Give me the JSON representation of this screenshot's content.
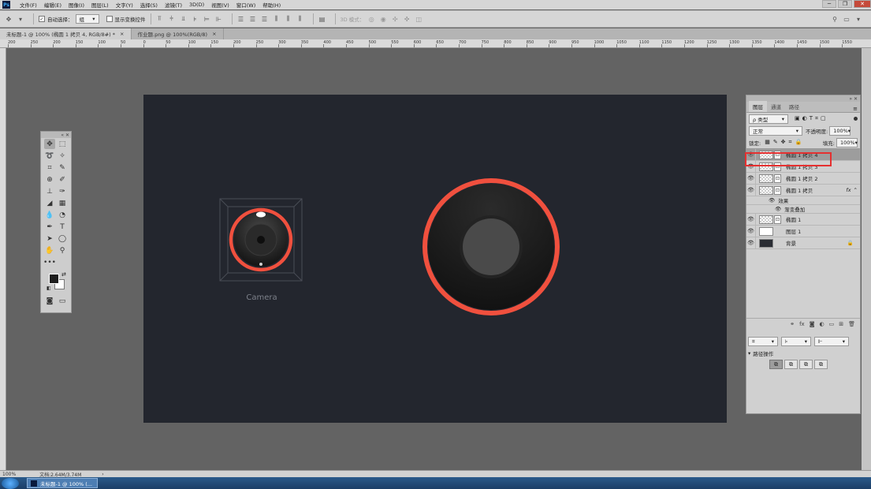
{
  "menubar": {
    "app_logo": "Ps",
    "items": [
      "文件(F)",
      "编辑(E)",
      "图像(I)",
      "图层(L)",
      "文字(Y)",
      "选择(S)",
      "滤镜(T)",
      "3D(D)",
      "视图(V)",
      "窗口(W)",
      "帮助(H)"
    ],
    "window_controls": [
      "─",
      "❐",
      "✕"
    ]
  },
  "options_bar": {
    "auto_select_label": "自动选择：",
    "auto_select_checked": "✓",
    "auto_select_value": "组",
    "show_transform_label": "显示变换控件",
    "mode_3d_label": "3D 模式："
  },
  "doc_tabs": [
    {
      "label": "未标题-1 @ 100% (椭圆 1 拷贝 4, RGB/8#) *",
      "close": "×"
    },
    {
      "label": "作业题.png @ 100%(RGB/8)",
      "close": "×"
    }
  ],
  "ruler_labels": [
    "200",
    "250",
    "200",
    "150",
    "100",
    "50",
    "0",
    "50",
    "100",
    "150",
    "200",
    "250",
    "300",
    "350",
    "400",
    "450",
    "500",
    "550",
    "600",
    "650",
    "700",
    "750",
    "800",
    "850",
    "900",
    "950",
    "1000",
    "1050",
    "1100",
    "1150",
    "1200",
    "1250",
    "1300",
    "1350",
    "1400",
    "1450",
    "1500",
    "1550"
  ],
  "canvas": {
    "small_icon_label": "Camera"
  },
  "colors": {
    "canvas_bg": "#23262e",
    "accent_ring": "#f0503e",
    "highlight_box": "#e53030"
  },
  "layers_panel": {
    "tabs": [
      "图层",
      "通道",
      "路径"
    ],
    "filter_label": "ρ 类型",
    "blend_mode": "正常",
    "opacity_label": "不透明度:",
    "opacity_value": "100%",
    "lock_label": "锁定:",
    "fill_label": "填充:",
    "fill_value": "100%",
    "layers": [
      {
        "name": "椭圆 1 拷贝 4"
      },
      {
        "name": "椭圆 1 拷贝 3"
      },
      {
        "name": "椭圆 1 拷贝 2"
      },
      {
        "name": "椭圆 1 拷贝",
        "fx": "fx"
      },
      {
        "name": "椭圆 1"
      },
      {
        "name": "图层 1"
      },
      {
        "name": "背景"
      }
    ],
    "effects_label": "效果",
    "gradient_overlay_label": "渐变叠加"
  },
  "paths_panel": {
    "title": "路径操作"
  },
  "statusbar": {
    "zoom": "100%",
    "doc_info": "文档:2.64M/3.74M"
  },
  "taskbar": {
    "item_label": "未标题-1 @ 100% (..."
  }
}
